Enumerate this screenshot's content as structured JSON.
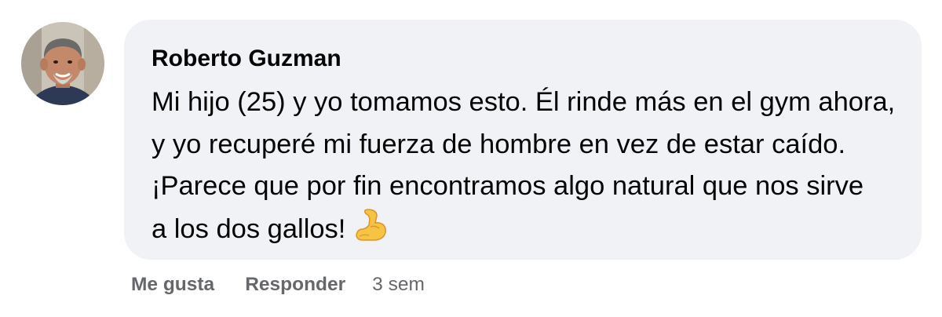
{
  "comment": {
    "author": "Roberto Guzman",
    "body_lines": [
      "Mi hijo (25) y yo tomamos esto. Él rinde más en el gym ahora,",
      "y yo recuperé mi fuerza de hombre en vez de estar caído.",
      "¡Parece que por fin encontramos algo natural que nos sirve",
      "a los dos gallos!"
    ],
    "emoji": "flexed-biceps-emoji",
    "avatar_icon": "profile-photo-avatar",
    "bubble_color": "#f0f2f5"
  },
  "actions": {
    "like_label": "Me gusta",
    "reply_label": "Responder",
    "timestamp": "3 sem"
  }
}
